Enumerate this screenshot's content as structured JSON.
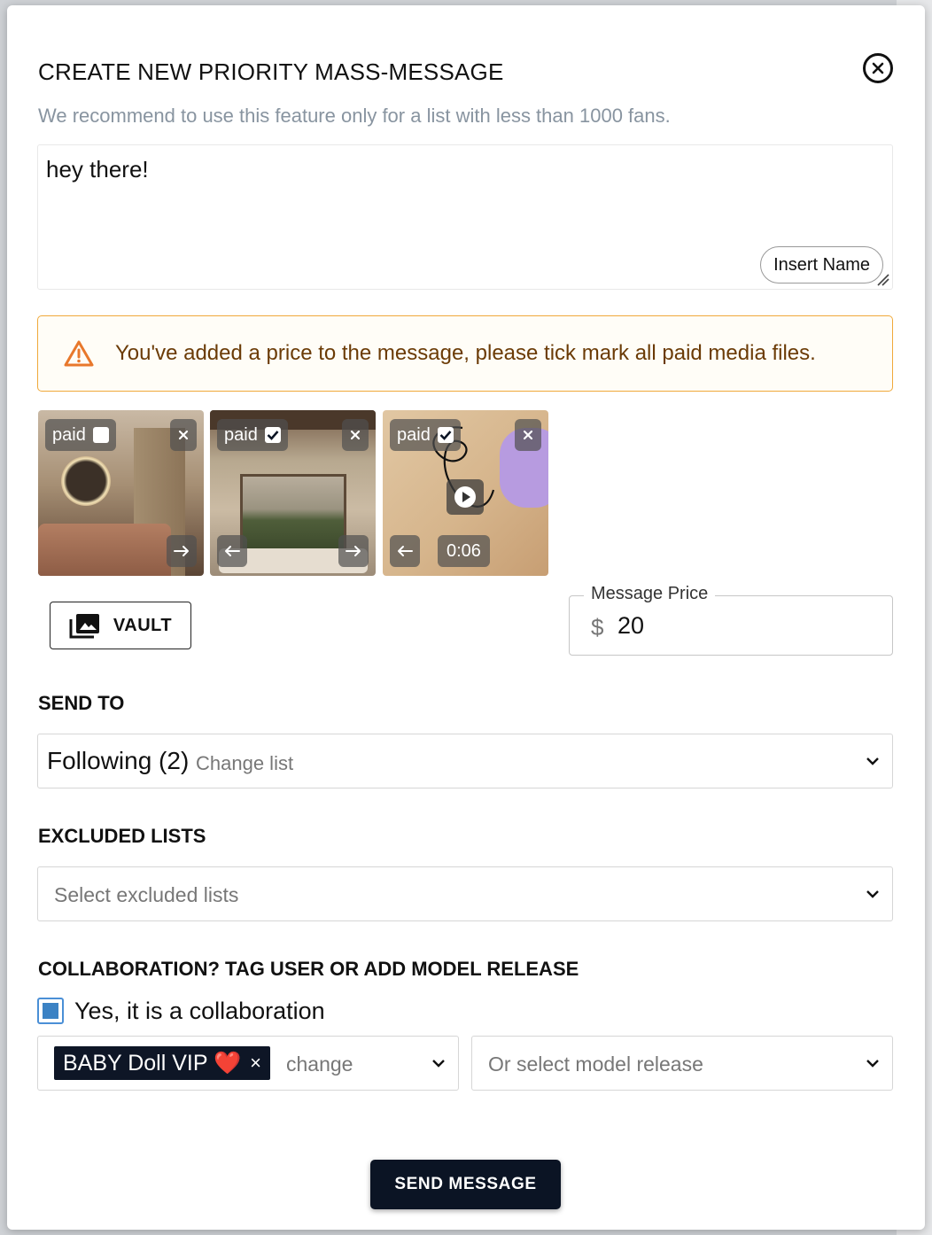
{
  "dialog": {
    "title": "CREATE NEW PRIORITY MASS-MESSAGE",
    "subtitle": "We recommend to use this feature only for a list with less than 1000 fans."
  },
  "message": {
    "text": "hey there!",
    "insert_name_label": "Insert Name"
  },
  "alert": {
    "text": "You've added a price to the message, please tick mark all paid media files.",
    "border_color": "#f0a93b",
    "icon": "warning-triangle-icon"
  },
  "media": [
    {
      "paid_label": "paid",
      "paid_checked": false,
      "type": "image"
    },
    {
      "paid_label": "paid",
      "paid_checked": true,
      "type": "image"
    },
    {
      "paid_label": "paid",
      "paid_checked": true,
      "type": "video",
      "duration": "0:06"
    }
  ],
  "vault": {
    "label": "VAULT"
  },
  "price": {
    "label": "Message Price",
    "currency": "$",
    "value": "20"
  },
  "send_to": {
    "heading": "SEND TO",
    "selected": "Following (2)",
    "change_label": "Change list"
  },
  "excluded": {
    "heading": "EXCLUDED LISTS",
    "placeholder": "Select excluded lists"
  },
  "collaboration": {
    "heading": "COLLABORATION? TAG USER OR ADD MODEL RELEASE",
    "checkbox_label": "Yes, it is a collaboration",
    "checked": true,
    "tag": "BABY Doll VIP ❤️",
    "change_label": "change",
    "model_release_placeholder": "Or select model release"
  },
  "send_button": {
    "label": "SEND MESSAGE",
    "color": "#0b1424"
  }
}
